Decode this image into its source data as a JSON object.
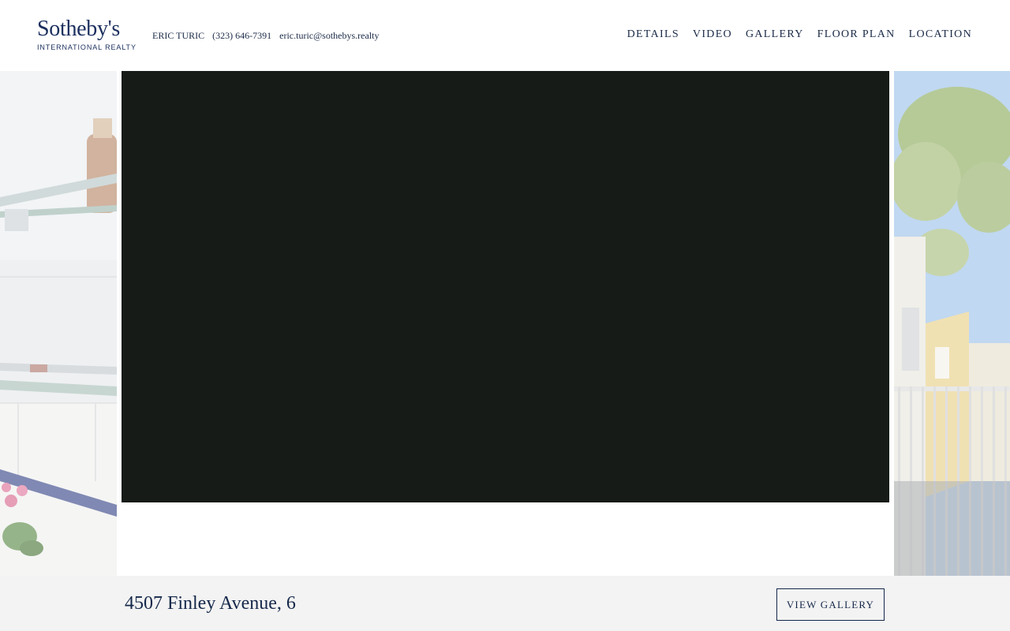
{
  "brand": {
    "name": "Sotheby's",
    "tagline": "INTERNATIONAL REALTY"
  },
  "contact": {
    "agent": "ERIC TURIC",
    "phone": "(323) 646-7391",
    "email": "eric.turic@sothebys.realty"
  },
  "nav": {
    "items": [
      {
        "label": "DETAILS"
      },
      {
        "label": "VIDEO"
      },
      {
        "label": "GALLERY"
      },
      {
        "label": "FLOOR PLAN"
      },
      {
        "label": "LOCATION"
      }
    ]
  },
  "footer": {
    "address": "4507 Finley Avenue, 6",
    "button_label": "VIEW GALLERY"
  },
  "colors": {
    "brand_navy": "#1b2f5e",
    "video_bg": "#161b17",
    "footer_bg": "#f3f3f3"
  }
}
